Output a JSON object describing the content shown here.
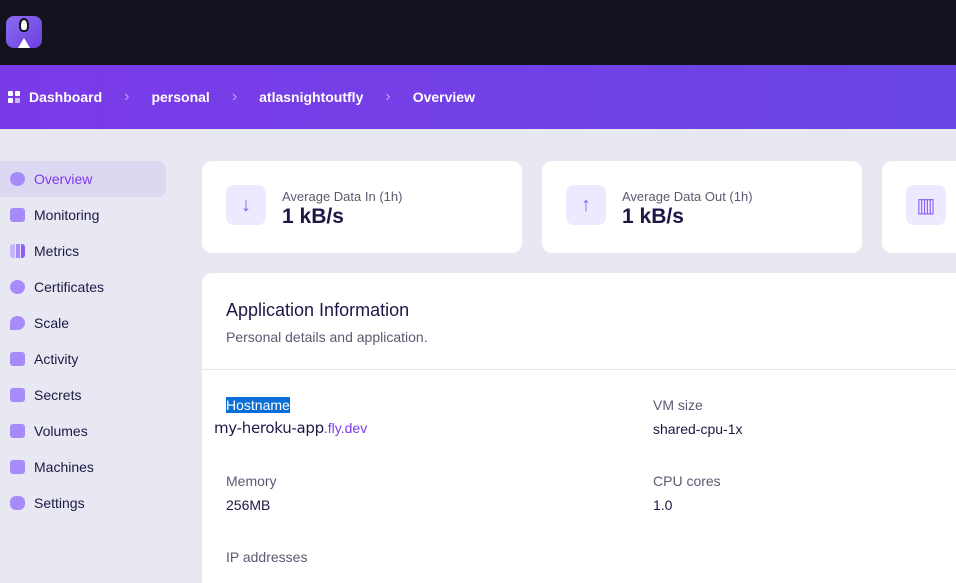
{
  "breadcrumb": [
    "Dashboard",
    "personal",
    "atlasnightoutfly",
    "Overview"
  ],
  "sidebar": {
    "items": [
      {
        "label": "Overview",
        "icon": "gauge-icon",
        "active": true
      },
      {
        "label": "Monitoring",
        "icon": "monitor-icon"
      },
      {
        "label": "Metrics",
        "icon": "bar-chart-icon"
      },
      {
        "label": "Certificates",
        "icon": "badge-check-icon"
      },
      {
        "label": "Scale",
        "icon": "sprout-icon"
      },
      {
        "label": "Activity",
        "icon": "stack-icon"
      },
      {
        "label": "Secrets",
        "icon": "lock-icon"
      },
      {
        "label": "Volumes",
        "icon": "archive-icon"
      },
      {
        "label": "Machines",
        "icon": "chip-icon"
      },
      {
        "label": "Settings",
        "icon": "toggles-icon"
      }
    ]
  },
  "stats": [
    {
      "label": "Average Data In (1h)",
      "value": "1 kB/s",
      "icon": "↓"
    },
    {
      "label": "Average Data Out (1h)",
      "value": "1 kB/s",
      "icon": "↑"
    },
    {
      "icon": "▥"
    }
  ],
  "info": {
    "title": "Application Information",
    "subtitle": "Personal details and application.",
    "hostname_label": "Hostname",
    "hostname": "my-heroku-app",
    "hostname_domain": ".fly.dev",
    "vm_label": "VM size",
    "vm": "shared-cpu-1x",
    "memory_label": "Memory",
    "memory": "256MB",
    "cpu_label": "CPU cores",
    "cpu": "1.0",
    "ip_label": "IP addresses"
  }
}
